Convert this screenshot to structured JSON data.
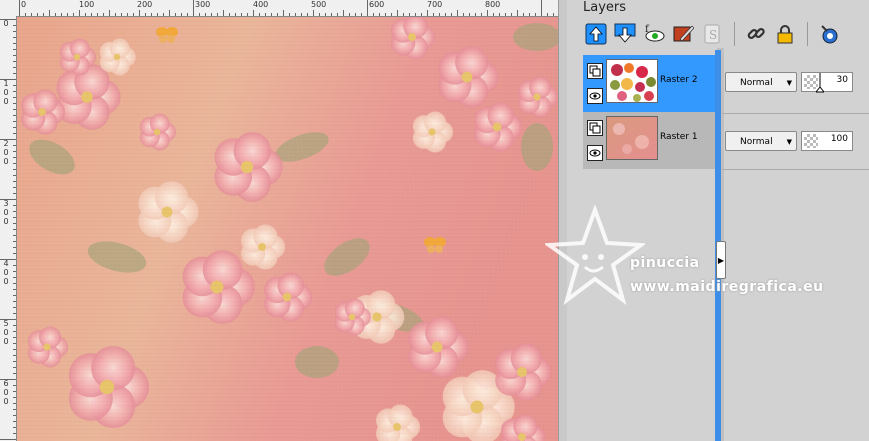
{
  "ruler": {
    "top_labels": [
      "0",
      "100",
      "200",
      "300",
      "400",
      "500",
      "600",
      "700",
      "800"
    ],
    "left_labels": [
      "0",
      "1 0 0",
      "2 0 0",
      "3 0 0",
      "4 0 0",
      "5 0 0",
      "6 0 0"
    ]
  },
  "panel": {
    "title": "Layers",
    "toolbar_icons": [
      "move-layer-up-icon",
      "move-layer-down-icon",
      "toggle-visibility-icon",
      "edit-layer-icon",
      "mask-icon",
      "link-icon",
      "lock-icon",
      "properties-icon"
    ],
    "layers": [
      {
        "name": "Raster 2",
        "blend": "Normal",
        "opacity": "30",
        "selected": true
      },
      {
        "name": "Raster 1",
        "blend": "Normal",
        "opacity": "100",
        "selected": false
      }
    ]
  },
  "watermark": {
    "name": "pinuccia",
    "url": "www.maidiregrafica.eu"
  },
  "colors": {
    "selected": "#3399ff",
    "panel": "#d2d2d2",
    "canvas_peach": "#e9a88e"
  }
}
